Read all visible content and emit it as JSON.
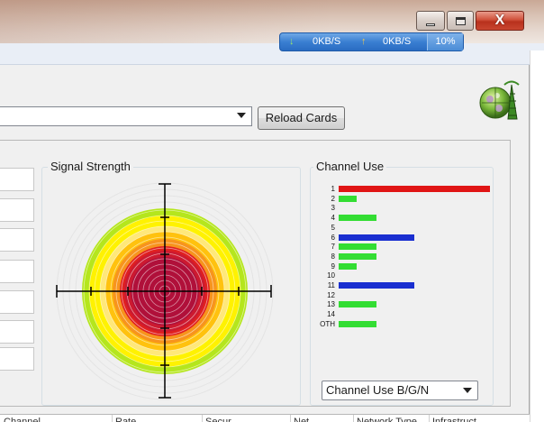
{
  "window": {
    "minimize_icon": "minimize-icon",
    "maximize_icon": "maximize-icon",
    "close_icon": "close-icon",
    "close_glyph": "X"
  },
  "netmeter": {
    "down_arrow": "↓",
    "down_value": "0KB/S",
    "up_arrow": "↑",
    "up_value": "0KB/S",
    "cpu": "10%"
  },
  "toolbar": {
    "card_select_value": "",
    "reload_label": "Reload Cards"
  },
  "signal_strength": {
    "title": "Signal Strength"
  },
  "channel_use": {
    "title": "Channel Use",
    "select_value": "Channel Use B/G/N",
    "channels": [
      {
        "label": "1",
        "value": 1.0,
        "color": "#e01515"
      },
      {
        "label": "2",
        "value": 0.12,
        "color": "#33dd33"
      },
      {
        "label": "3",
        "value": 0,
        "color": ""
      },
      {
        "label": "4",
        "value": 0.25,
        "color": "#33dd33"
      },
      {
        "label": "5",
        "value": 0,
        "color": ""
      },
      {
        "label": "6",
        "value": 0.5,
        "color": "#1a2fd0"
      },
      {
        "label": "7",
        "value": 0.25,
        "color": "#33dd33"
      },
      {
        "label": "8",
        "value": 0.25,
        "color": "#33dd33"
      },
      {
        "label": "9",
        "value": 0.12,
        "color": "#33dd33"
      },
      {
        "label": "10",
        "value": 0,
        "color": ""
      },
      {
        "label": "11",
        "value": 0.5,
        "color": "#1a2fd0"
      },
      {
        "label": "12",
        "value": 0,
        "color": ""
      },
      {
        "label": "13",
        "value": 0.25,
        "color": "#33dd33"
      },
      {
        "label": "14",
        "value": 0,
        "color": ""
      },
      {
        "label": "OTH",
        "value": 0.25,
        "color": "#33dd33"
      }
    ]
  },
  "colors": {
    "ring_outer": "#b5e61d",
    "ring_yellow": "#fff200",
    "ring_orange": "#ffc20e",
    "ring_darkorange": "#f7941d",
    "ring_red": "#e02020",
    "ring_core": "#b0103a"
  },
  "table_header": {
    "columns": [
      "Channel",
      "Rate",
      "Secur...",
      "Net...",
      "Network Type",
      "Infrastruct..."
    ]
  }
}
